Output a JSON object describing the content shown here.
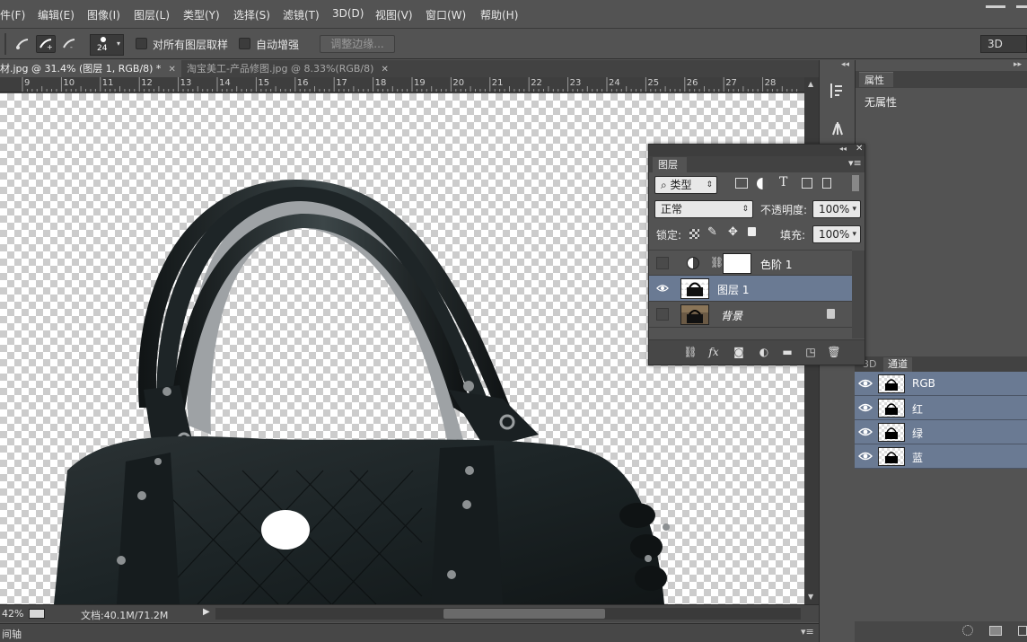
{
  "menu": [
    "件(F)",
    "编辑(E)",
    "图像(I)",
    "图层(L)",
    "类型(Y)",
    "选择(S)",
    "滤镜(T)",
    "3D(D)",
    "视图(V)",
    "窗口(W)",
    "帮助(H)"
  ],
  "options": {
    "brush_size": "24",
    "sample_all_layers": "对所有图层取样",
    "auto_enhance": "自动增强",
    "refine_edge": "调整边缘...",
    "workspace": "3D"
  },
  "tabs": [
    {
      "label": "材.jpg @ 31.4% (图层 1, RGB/8) *",
      "active": true
    },
    {
      "label": "淘宝美工-产品修图.jpg @ 8.33%(RGB/8)",
      "active": false
    }
  ],
  "ruler_ticks": [
    "9",
    "10",
    "11",
    "12",
    "13",
    "14",
    "15",
    "16",
    "17",
    "18",
    "19",
    "20",
    "21",
    "22",
    "23",
    "24",
    "25",
    "26",
    "27",
    "28"
  ],
  "status": {
    "zoom": "42%",
    "doc": "文档:40.1M/71.2M",
    "timeline": "间轴"
  },
  "properties": {
    "tab": "属性",
    "body": "无属性"
  },
  "layers_panel": {
    "tab": "图层",
    "filter_kind": "类型",
    "blend_mode": "正常",
    "opacity_label": "不透明度:",
    "opacity": "100%",
    "lock_label": "锁定:",
    "fill_label": "填充:",
    "fill": "100%",
    "layers": [
      {
        "name": "色阶 1",
        "visible": false,
        "selected": false
      },
      {
        "name": "图层 1",
        "visible": true,
        "selected": true
      },
      {
        "name": "背景",
        "visible": false,
        "selected": false
      }
    ]
  },
  "channels_panel": {
    "tabs": [
      "3D",
      "通道"
    ],
    "channels": [
      "RGB",
      "红",
      "绿",
      "蓝"
    ]
  },
  "colors": {
    "selection": "#6a7a93",
    "panel": "#535353"
  }
}
